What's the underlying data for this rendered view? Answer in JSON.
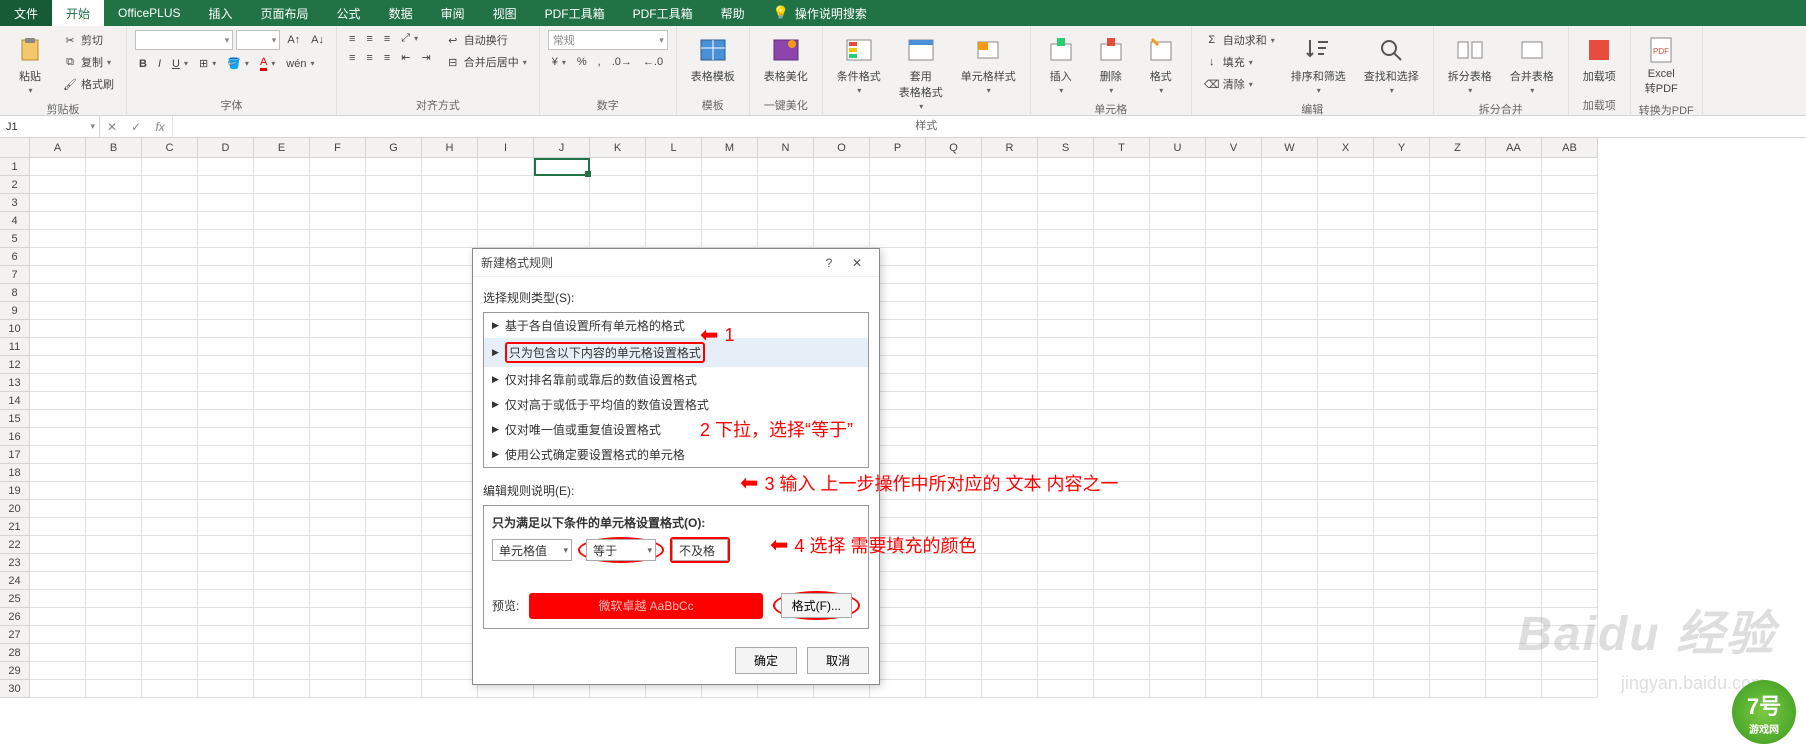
{
  "menu": {
    "tabs": [
      "文件",
      "开始",
      "OfficePLUS",
      "插入",
      "页面布局",
      "公式",
      "数据",
      "审阅",
      "视图",
      "PDF工具箱",
      "PDF工具箱",
      "帮助"
    ],
    "active_index": 1,
    "tell_me": "操作说明搜索"
  },
  "ribbon": {
    "clipboard": {
      "paste": "粘贴",
      "cut": "剪切",
      "copy": "复制",
      "painter": "格式刷",
      "label": "剪贴板"
    },
    "font": {
      "family_placeholder": "",
      "size_placeholder": "",
      "label": "字体",
      "bold": "B",
      "italic": "I",
      "underline": "U"
    },
    "alignment": {
      "wrap": "自动换行",
      "merge": "合并后居中",
      "label": "对齐方式"
    },
    "number": {
      "format": "常规",
      "label": "数字"
    },
    "template": {
      "btn": "表格模板",
      "label": "模板"
    },
    "beautify": {
      "btn": "表格美化",
      "label": "一键美化"
    },
    "styles": {
      "cond": "条件格式",
      "table": "套用\n表格格式",
      "cell": "单元格样式",
      "label": "样式"
    },
    "cells": {
      "insert": "插入",
      "delete": "删除",
      "format": "格式",
      "label": "单元格"
    },
    "editing": {
      "sum": "自动求和",
      "fill": "填充",
      "clear": "清除",
      "sort": "排序和筛选",
      "find": "查找和选择",
      "label": "编辑"
    },
    "split": {
      "split": "拆分表格",
      "merge": "合并表格",
      "label": "拆分合并"
    },
    "addin": {
      "btn": "加载项",
      "label": "加载项"
    },
    "pdf": {
      "btn": "Excel\n转PDF",
      "label": "转换为PDF"
    }
  },
  "namebox": {
    "value": "J1"
  },
  "grid": {
    "columns": [
      "A",
      "B",
      "C",
      "D",
      "E",
      "F",
      "G",
      "H",
      "I",
      "J",
      "K",
      "L",
      "M",
      "N",
      "O",
      "P",
      "Q",
      "R",
      "S",
      "T",
      "U",
      "V",
      "W",
      "X",
      "Y",
      "Z",
      "AA",
      "AB"
    ],
    "row_count": 30,
    "active": {
      "col_index": 9,
      "row_index": 0
    }
  },
  "dialog": {
    "title": "新建格式规则",
    "rule_type_label": "选择规则类型(S):",
    "rule_types": [
      "基于各自值设置所有单元格的格式",
      "只为包含以下内容的单元格设置格式",
      "仅对排名靠前或靠后的数值设置格式",
      "仅对高于或低于平均值的数值设置格式",
      "仅对唯一值或重复值设置格式",
      "使用公式确定要设置格式的单元格"
    ],
    "selected_rule_index": 1,
    "edit_label": "编辑规则说明(E):",
    "edit_heading": "只为满足以下条件的单元格设置格式(O):",
    "left_select": "单元格值",
    "op_select": "等于",
    "value_input": "不及格",
    "preview_label": "预览:",
    "preview_text": "微软卓越 AaBbCc",
    "format_btn": "格式(F)...",
    "ok": "确定",
    "cancel": "取消",
    "help": "?",
    "close": "✕"
  },
  "annotations": {
    "a1": "1",
    "a2": "2 下拉，选择“等于”",
    "a3": "3 输入 上一步操作中所对应的 文本 内容之一",
    "a4": "4 选择 需要填充的颜色"
  },
  "watermark": {
    "main": "Baidu 经验",
    "sub": "jingyan.baidu.com"
  },
  "badge": {
    "num": "7号",
    "txt": "游戏网"
  }
}
